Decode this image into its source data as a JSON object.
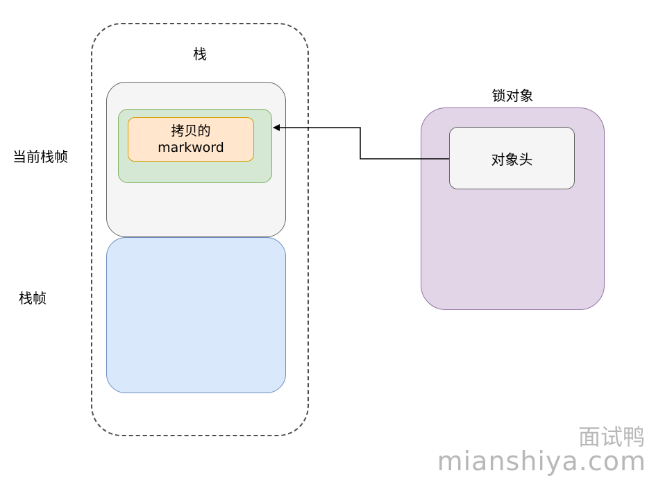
{
  "stack": {
    "title": "栈",
    "current_frame_label": "当前栈帧",
    "frame_label": "栈帧",
    "copied_markword": "拷贝的\nmarkword"
  },
  "lock_object": {
    "title": "锁对象",
    "header": "对象头"
  },
  "watermark": {
    "brand": "面试鸭",
    "url": "mianshiya.com"
  },
  "colors": {
    "current_frame_fill": "#f5f5f5",
    "lock_record_fill": "#d5e8d4",
    "markword_fill": "#ffe6cc",
    "frame_fill": "#dae8fc",
    "lock_object_fill": "#e1d5e7",
    "object_header_fill": "#f5f5f5"
  }
}
